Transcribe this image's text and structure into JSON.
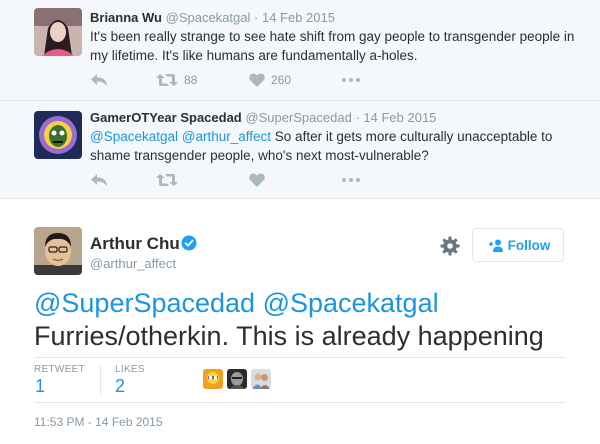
{
  "tweets": [
    {
      "name": "Brianna Wu",
      "handle": "@Spacekatgal",
      "dot": "·",
      "date": "14 Feb 2015",
      "text": "It's been really strange to see hate shift from gay people to transgender people in my lifetime. It's like humans are fundamentally a-holes.",
      "retweets": "88",
      "likes": "260"
    },
    {
      "name": "GamerOTYear Spacedad",
      "handle": "@SuperSpacedad",
      "dot": "·",
      "date": "14 Feb 2015",
      "mention1": "@Spacekatgal",
      "mention2": "@arthur_affect",
      "text": " So after it gets more culturally unacceptable to shame transgender people, who's next most-vulnerable?"
    }
  ],
  "main": {
    "name": "Arthur Chu",
    "handle": "@arthur_affect",
    "follow_label": "Follow",
    "mention1": "@SuperSpacedad",
    "mention2": "@Spacekatgal",
    "text": "Furries/otherkin. This is already happening",
    "retweet_label": "RETWEET",
    "retweet_count": "1",
    "likes_label": "LIKES",
    "likes_count": "2",
    "timestamp": "11:53 PM - 14 Feb 2015"
  },
  "icons": {
    "reply": "reply-icon",
    "retweet": "retweet-icon",
    "like": "heart-icon",
    "more": "more-icon",
    "settings": "gear-icon",
    "verified": "verified-badge-icon",
    "follow": "add-user-icon"
  },
  "colors": {
    "link": "#1b95e0",
    "muted": "#8899a6",
    "icon": "#aab8c2",
    "context_bg": "#f5f8fa",
    "border": "#e1e8ed"
  }
}
